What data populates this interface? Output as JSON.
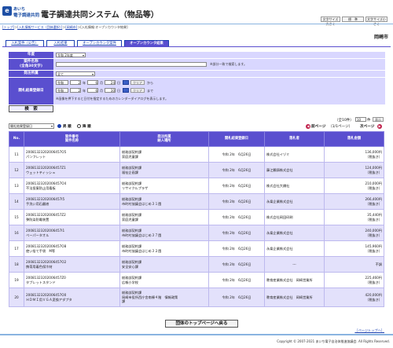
{
  "header": {
    "logo_mark": "e",
    "logo_top": "あいち",
    "logo_bottom": "電子調達共同",
    "title": "電子調達共同システム（物品等）",
    "btn_large": "文字サイズ大きく",
    "btn_standard": "標　準",
    "btn_small": "文字サイズ小さく"
  },
  "breadcrumb": {
    "link_top": "[トップ]",
    "sep1": "＞",
    "link_service": "[入札情報サービス（団体選択）]",
    "sep2": "＞",
    "link_city": "[岡崎市]",
    "sep3": "＞",
    "current": "[入札情報:オープンカウンタ結果]"
  },
  "city_name": "岡崎市",
  "tabs": [
    {
      "label": "入札案件（公告）"
    },
    {
      "label": "入札結果"
    },
    {
      "label": "オープンカウンタ案件"
    },
    {
      "label": "オープンカウンタ結果"
    }
  ],
  "form": {
    "year_label": "年度",
    "year_value": "令和 2年度",
    "case_label1": "案件名称",
    "case_label2": "(全角30文字)",
    "case_value": "",
    "case_note": "※部分一致で検索します。",
    "dept_label": "発注所属",
    "dept_value": "全て",
    "date_label": "開札結果登録日",
    "from": {
      "era": "令和",
      "year": "2",
      "y": "年",
      "month": "6",
      "m": "月",
      "day": "24",
      "d": "日",
      "clear": "クリア",
      "suffix": "から"
    },
    "to": {
      "era": "令和",
      "year": "2",
      "y": "年",
      "month": "6",
      "m": "月",
      "day": "30",
      "d": "日",
      "clear": "クリア",
      "suffix": "まで"
    },
    "date_note": "※画像を押下すると日付を指定するためのカレンダーダイアログを表示します。",
    "search_button": "検　索"
  },
  "results_controls": {
    "sort_select": "開札結果登録日",
    "sort_asc": "昇 順",
    "sort_desc": "降 順",
    "prev_icon": "◀",
    "prev": "前ページ",
    "page_info": "（1/1ページ）",
    "next": "次ページ",
    "next_icon": "▶",
    "total": "（全10件）",
    "per_page": "10",
    "per_page_unit": "件",
    "per_page_go": "表示"
  },
  "table": {
    "headers": {
      "no": "No.",
      "case_no": "案件番号",
      "case_name": "案件名称",
      "dept1": "発注所属",
      "dept2": "納入場所",
      "date": "開札結果登録日",
      "winner": "落札者",
      "amount": "落札金額"
    },
    "rows": [
      {
        "no": "11",
        "code": "20081323202006457O5",
        "name": "パンフレット",
        "dept": "総務部契約課",
        "place": "家庭児童課",
        "date": "令和 2年　6月26日",
        "winner": "株式会社イヅミ",
        "amount": "136,000円",
        "tax": "（税抜き）"
      },
      {
        "no": "12",
        "code": "20081323202006457Z1",
        "name": "ウェットティッシュ",
        "dept": "総務部契約課",
        "place": "福祉企画課",
        "date": "令和 2年　6月26日",
        "winner": "藤江鶴鋳株式会社",
        "amount": "124,000円",
        "tax": "（税抜き）"
      },
      {
        "no": "13",
        "code": "20081323202006457O4",
        "name": "不法投棄防止用看板",
        "dept": "総務部契約課",
        "place": "リサイクルプラザ",
        "date": "令和 2年　6月26日",
        "winner": "株式会社大橋社",
        "amount": "210,000円",
        "tax": "（税抜き）"
      },
      {
        "no": "14",
        "code": "20081323202006457I5",
        "name": "手洗い用石鹸液",
        "dept": "総務部契約課",
        "place": "市町村協議会はじめ３１園",
        "date": "令和 2年　6月26日",
        "winner": "永楽企業株式会社",
        "amount": "266,400円",
        "tax": "（税抜き）"
      },
      {
        "no": "15",
        "code": "20081323202006457Z2",
        "name": "弾防染防電装置",
        "dept": "総務部契約課",
        "place": "家庭児童課",
        "date": "令和 2年　6月26日",
        "winner": "株式会社岡田印刷",
        "amount": "35,440円",
        "tax": "（税抜き）"
      },
      {
        "no": "16",
        "code": "20081323202006457I1",
        "name": "ペーパータオル",
        "dept": "総務部契約課",
        "place": "市町村協議会はじめ３７園",
        "date": "令和 2年　6月26日",
        "winner": "永楽企業株式会社",
        "amount": "240,000円",
        "tax": "（税抜き）"
      },
      {
        "no": "17",
        "code": "20081323202006457O8",
        "name": "使い捨て手袋　M等",
        "dept": "総務部契約課",
        "place": "市町村協議会はじめ３２園",
        "date": "令和 2年　6月26日",
        "winner": "永楽企業株式会社",
        "amount": "145,960円",
        "tax": "（税抜き）"
      },
      {
        "no": "18",
        "code": "20081323202006457O2",
        "name": "携帯用着色保冷材",
        "dept": "総務部契約課",
        "place": "安全安心課",
        "date": "令和 2年　6月26日",
        "winner": "---",
        "amount": "不調",
        "tax": ""
      },
      {
        "no": "19",
        "code": "20081323202006457Z0",
        "name": "タブレットスタンド",
        "dept": "総務部契約課",
        "place": "広報小学校",
        "date": "令和 2年　6月26日",
        "winner": "教育産業株式会社　岡崎営業所",
        "amount": "225,460円",
        "tax": "（税抜き）"
      },
      {
        "no": "20",
        "code": "20081323202006457O0",
        "name": "ＨＤＭＩ用ＶＧＡ変換アダプタ",
        "dept": "総務部契約課",
        "place": "岡崎市役所西庁舎南棟４階　情報政策",
        "place2": "課",
        "date": "令和 2年　6月26日",
        "winner": "教育産業株式会社　岡崎営業所",
        "amount": "420,000円",
        "tax": "（税抜き）"
      }
    ]
  },
  "return_button": "団体のトップページへ戻る",
  "page_top": "［ページトップへ］",
  "copyright": "Copyright © 2007-2021 あいち電子自治体推進協議会. All Rights Reserved.",
  "colors": {
    "accent": "#5a4fcf",
    "form_bg": "#d9d7ff",
    "row_alt": "#e3e1fb",
    "link": "#1a3fb0"
  }
}
